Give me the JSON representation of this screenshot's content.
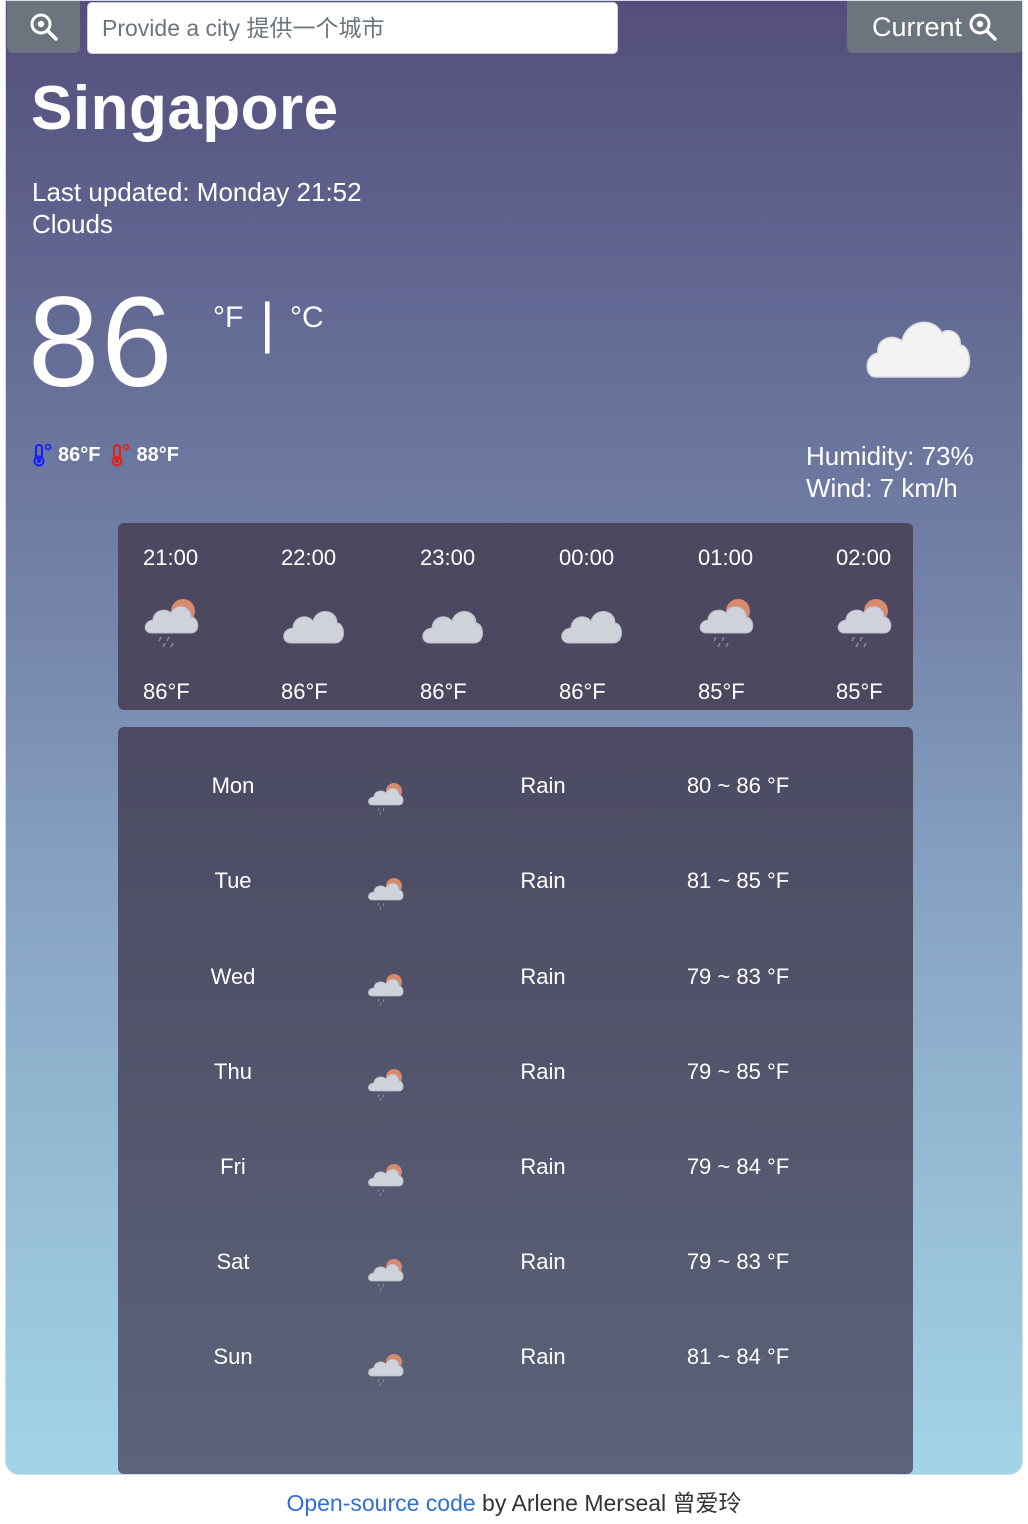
{
  "header": {
    "search_icon": "search-icon",
    "city_placeholder": "Provide a city 提供一个城市",
    "current_label": "Current",
    "current_icon": "search-icon"
  },
  "weather": {
    "city": "Singapore",
    "last_updated": "Last updated: Monday 21:52",
    "description": "Clouds",
    "temperature": "86",
    "unit_f": "°F",
    "unit_sep": "|",
    "unit_c": "°C",
    "icon": "cloud-icon",
    "min_temp": "86°F",
    "max_temp": "88°F",
    "min_icon": "thermometer-cold-icon",
    "max_icon": "thermometer-hot-icon",
    "humidity": "Humidity: 73%",
    "wind": "Wind: 7 km/h"
  },
  "hourly": [
    {
      "time": "21:00",
      "temp": "86°F",
      "icon": "sun-rain-cloud-icon"
    },
    {
      "time": "22:00",
      "temp": "86°F",
      "icon": "cloud-icon"
    },
    {
      "time": "23:00",
      "temp": "86°F",
      "icon": "cloud-icon"
    },
    {
      "time": "00:00",
      "temp": "86°F",
      "icon": "cloud-icon"
    },
    {
      "time": "01:00",
      "temp": "85°F",
      "icon": "sun-rain-cloud-icon"
    },
    {
      "time": "02:00",
      "temp": "85°F",
      "icon": "sun-rain-cloud-icon"
    }
  ],
  "daily": [
    {
      "day": "Mon",
      "desc": "Rain",
      "range": "80 ~ 86 °F",
      "icon": "sun-rain-cloud-icon"
    },
    {
      "day": "Tue",
      "desc": "Rain",
      "range": "81 ~ 85 °F",
      "icon": "sun-rain-cloud-icon"
    },
    {
      "day": "Wed",
      "desc": "Rain",
      "range": "79 ~ 83 °F",
      "icon": "sun-rain-cloud-icon"
    },
    {
      "day": "Thu",
      "desc": "Rain",
      "range": "79 ~ 85 °F",
      "icon": "sun-rain-cloud-icon"
    },
    {
      "day": "Fri",
      "desc": "Rain",
      "range": "79 ~ 84 °F",
      "icon": "sun-rain-cloud-icon"
    },
    {
      "day": "Sat",
      "desc": "Rain",
      "range": "79 ~ 83 °F",
      "icon": "sun-rain-cloud-icon"
    },
    {
      "day": "Sun",
      "desc": "Rain",
      "range": "81 ~ 84 °F",
      "icon": "sun-rain-cloud-icon"
    }
  ],
  "footer": {
    "link_text": "Open-source code",
    "author_text": " by Arlene Merseal 曾爱玲"
  },
  "colors": {
    "gradient_top": "#544e7c",
    "gradient_bottom": "#a2d4e8",
    "panel": "#4b4860",
    "button": "#6c757d",
    "link": "#2f6fd6"
  }
}
